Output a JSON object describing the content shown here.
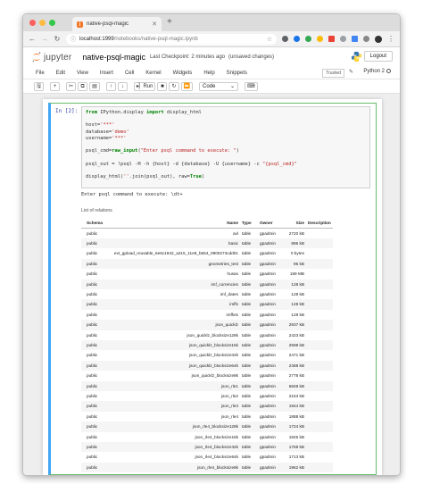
{
  "browser": {
    "tab_title": "native-psql-magic",
    "tab_favicon": "jupyter-favicon",
    "url_host": "localhost:1999",
    "url_path": "/notebooks/native-psql-magic.ipynb"
  },
  "header": {
    "logo_text": "jupyter",
    "notebook_name": "native-psql-magic",
    "checkpoint": "Last Checkpoint: 2 minutes ago",
    "unsaved": "(unsaved changes)",
    "logout_label": "Logout"
  },
  "menu": {
    "items": [
      "File",
      "Edit",
      "View",
      "Insert",
      "Cell",
      "Kernel",
      "Widgets",
      "Help",
      "Snippets"
    ],
    "trusted_label": "Trusted",
    "kernel_label": "Python 2"
  },
  "toolbar": {
    "run_label": "Run",
    "cell_type": "Code"
  },
  "cell": {
    "prompt": "In [2]:",
    "stdout": "Enter psql command to execute: \\dt+",
    "caption": "List of relations"
  },
  "table": {
    "headers": [
      "Schema",
      "Name",
      "Type",
      "Owner",
      "Size",
      "Description"
    ],
    "rows": [
      [
        "public",
        "avl",
        "table",
        "gpadmin",
        "2720 kB",
        ""
      ],
      [
        "public",
        "basic",
        "table",
        "gpadmin",
        "896 kB",
        ""
      ],
      [
        "public",
        "ext_gpload_reusable_6e6c1942_a215_11e8_b664_0800273cdd01",
        "table",
        "gpadmin",
        "0 bytes",
        ""
      ],
      [
        "public",
        "geometries_test",
        "table",
        "gpadmin",
        "96 kB",
        ""
      ],
      [
        "public",
        "husas",
        "table",
        "gpadmin",
        "169 MB",
        ""
      ],
      [
        "public",
        "imf_currencies",
        "table",
        "gpadmin",
        "128 kB",
        ""
      ],
      [
        "public",
        "imf_dates",
        "table",
        "gpadmin",
        "128 kB",
        ""
      ],
      [
        "public",
        "imffx",
        "table",
        "gpadmin",
        "128 kB",
        ""
      ],
      [
        "public",
        "imffxts",
        "table",
        "gpadmin",
        "128 kB",
        ""
      ],
      [
        "public",
        "json_quicklz",
        "table",
        "gpadmin",
        "2937 kB",
        ""
      ],
      [
        "public",
        "json_quicklz_blocksize128k",
        "table",
        "gpadmin",
        "2423 kB",
        ""
      ],
      [
        "public",
        "json_quicklz_blocksize16k",
        "table",
        "gpadmin",
        "2598 kB",
        ""
      ],
      [
        "public",
        "json_quicklz_blocksize32k",
        "table",
        "gpadmin",
        "2471 kB",
        ""
      ],
      [
        "public",
        "json_quicklz_blocksize64k",
        "table",
        "gpadmin",
        "2388 kB",
        ""
      ],
      [
        "public",
        "json_quicklz_blocksize8k",
        "table",
        "gpadmin",
        "2778 kB",
        ""
      ],
      [
        "public",
        "json_rle1",
        "table",
        "gpadmin",
        "6848 kB",
        ""
      ],
      [
        "public",
        "json_rle2",
        "table",
        "gpadmin",
        "2163 kB",
        ""
      ],
      [
        "public",
        "json_rle3",
        "table",
        "gpadmin",
        "1944 kB",
        ""
      ],
      [
        "public",
        "json_rle4",
        "table",
        "gpadmin",
        "1888 kB",
        ""
      ],
      [
        "public",
        "json_rle4_blocksize128k",
        "table",
        "gpadmin",
        "1724 kB",
        ""
      ],
      [
        "public",
        "json_rle4_blocksize16k",
        "table",
        "gpadmin",
        "1845 kB",
        ""
      ],
      [
        "public",
        "json_rle4_blocksize32k",
        "table",
        "gpadmin",
        "1768 kB",
        ""
      ],
      [
        "public",
        "json_rle4_blocksize64k",
        "table",
        "gpadmin",
        "1713 kB",
        ""
      ],
      [
        "public",
        "json_rle4_blocksize8k",
        "table",
        "gpadmin",
        "1962 kB",
        ""
      ],
      [
        "public",
        "json_standard",
        "table",
        "gpadmin",
        "7432 kB",
        ""
      ]
    ]
  }
}
